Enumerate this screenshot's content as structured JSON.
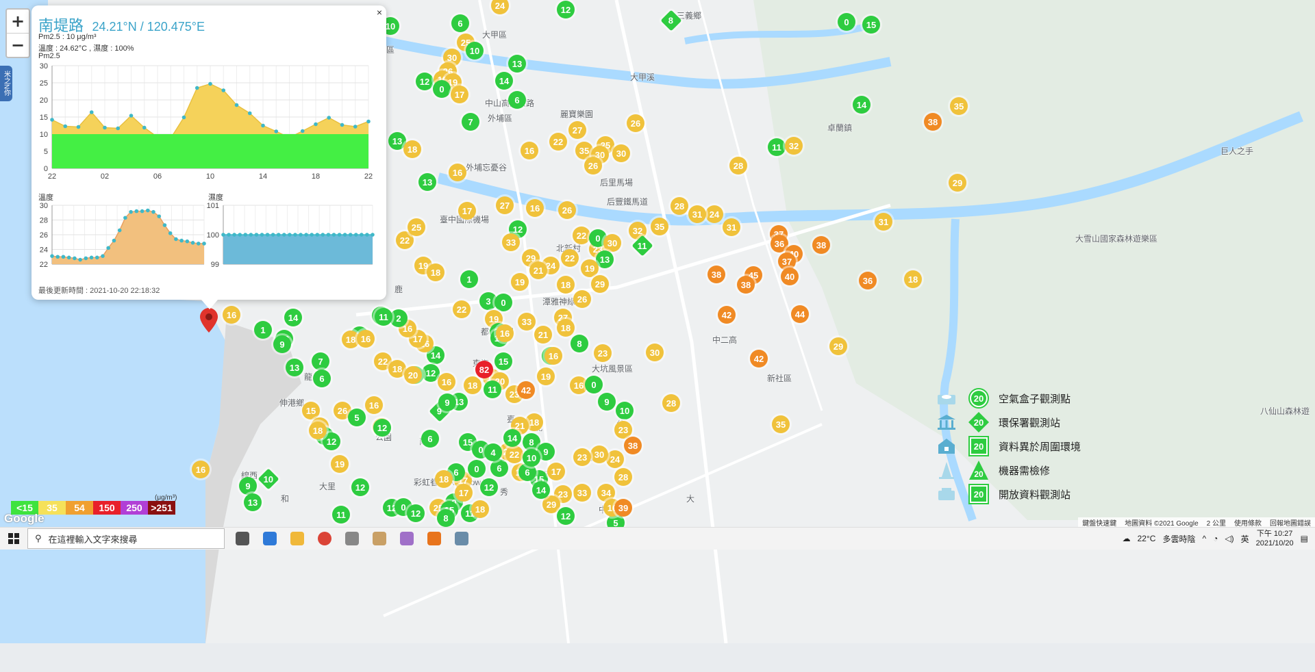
{
  "popup": {
    "station_name": "南堤路",
    "coordinates": "24.21°N / 120.475°E",
    "pm25_reading": "Pm2.5 : 10 μg/m³",
    "temp_humidity": "溫度 : 24.62°C , 濕度 : 100%",
    "pm25_chart_title": "Pm2.5",
    "temp_chart_title": "溫度",
    "humidity_chart_title": "濕度",
    "last_update": "最後更新時間 : 2021-10-20 22:18:32",
    "close_label": "×"
  },
  "chart_data": [
    {
      "type": "area",
      "title": "Pm2.5",
      "x_ticks": [
        "22",
        "02",
        "06",
        "10",
        "14",
        "18",
        "22"
      ],
      "ylim": [
        0,
        30
      ],
      "y_ticks": [
        0,
        5,
        10,
        15,
        20,
        25,
        30
      ],
      "grid": true,
      "series": [
        {
          "values": [
            14.2,
            12.3,
            12.1,
            16.4,
            11.9,
            11.7,
            15.4,
            11.9,
            9.1,
            8.8,
            14.9,
            23.5,
            24.7,
            22.8,
            18.5,
            16.1,
            12.5,
            10.8,
            9.0,
            10.9,
            12.9,
            14.8,
            12.7,
            12.2,
            13.7
          ]
        },
        {
          "values": [
            10,
            10,
            10,
            10,
            10,
            10,
            10,
            10,
            10,
            10,
            10,
            10,
            10,
            10,
            10,
            10,
            10,
            10,
            10,
            10,
            10,
            10,
            10,
            10,
            10
          ]
        }
      ]
    },
    {
      "type": "area",
      "title": "溫度",
      "ylim": [
        22,
        30
      ],
      "y_ticks": [
        22,
        24,
        26,
        28,
        30
      ],
      "grid": true,
      "values": [
        23.1,
        23.0,
        23.0,
        22.9,
        22.8,
        22.6,
        22.8,
        22.9,
        22.9,
        23.1,
        24.2,
        25.2,
        26.6,
        28.3,
        29.1,
        29.2,
        29.2,
        29.3,
        29.1,
        28.5,
        27.3,
        26.2,
        25.4,
        25.2,
        25.1,
        24.9,
        24.8,
        24.8
      ]
    },
    {
      "type": "area",
      "title": "濕度",
      "ylim": [
        99,
        101
      ],
      "y_ticks": [
        99,
        100,
        101
      ],
      "grid": true,
      "values": [
        100,
        100,
        100,
        100,
        100,
        100,
        100,
        100,
        100,
        100,
        100,
        100,
        100,
        100,
        100,
        100,
        100,
        100,
        100,
        100,
        100,
        100,
        100,
        100,
        100,
        100,
        100,
        100
      ]
    }
  ],
  "map": {
    "zoom_in": "+",
    "zoom_out": "−",
    "side_tab": "米之N你",
    "highlighted_value": "82",
    "places": [
      "三義鄉",
      "大甲區",
      "大安區",
      "外埔區",
      "中山高速公路",
      "麗寶樂園",
      "外埔忘憂谷",
      "卓蘭鎮",
      "巨人之手",
      "后里馬場",
      "后豐鐵馬道",
      "臺中國際機場",
      "北新村",
      "潭雅神綠園",
      "大坑風景區",
      "新社區",
      "中二高",
      "都會公園",
      "東海",
      "伸港鄉",
      "和",
      "線西",
      "大里",
      "彩虹眷村 Rainbow V",
      "大雪山國家森林遊樂區",
      "八仙山森林遊",
      "南",
      "龍",
      "公園",
      "大甲溪",
      "秀",
      "鹿",
      "大",
      "光",
      "石",
      "西",
      "北",
      "公",
      "臺",
      "大",
      "中"
    ],
    "markers": [
      {
        "v": "10",
        "c": "#2ecc40"
      },
      {
        "v": "24",
        "c": "#f0c23b"
      },
      {
        "v": "12",
        "c": "#2ecc40"
      },
      {
        "v": "8",
        "c": "#2ecc40",
        "d": true
      },
      {
        "v": "0",
        "c": "#2ecc40"
      },
      {
        "v": "15",
        "c": "#2ecc40"
      },
      {
        "v": "6",
        "c": "#2ecc40"
      },
      {
        "v": "25",
        "c": "#f0c23b"
      },
      {
        "v": "10",
        "c": "#2ecc40"
      },
      {
        "v": "30",
        "c": "#f0c23b"
      },
      {
        "v": "13",
        "c": "#2ecc40"
      },
      {
        "v": "26",
        "c": "#f0c23b"
      },
      {
        "v": "12",
        "c": "#2ecc40"
      },
      {
        "v": "18",
        "c": "#f0c23b"
      },
      {
        "v": "19",
        "c": "#f0c23b"
      },
      {
        "v": "0",
        "c": "#2ecc40"
      },
      {
        "v": "17",
        "c": "#f0c23b"
      },
      {
        "v": "14",
        "c": "#2ecc40"
      },
      {
        "v": "6",
        "c": "#2ecc40"
      },
      {
        "v": "7",
        "c": "#2ecc40"
      },
      {
        "v": "27",
        "c": "#f0c23b"
      },
      {
        "v": "26",
        "c": "#f0c23b"
      },
      {
        "v": "14",
        "c": "#2ecc40"
      },
      {
        "v": "38",
        "c": "#f08a24"
      },
      {
        "v": "35",
        "c": "#f0c23b"
      },
      {
        "v": "13",
        "c": "#2ecc40"
      },
      {
        "v": "18",
        "c": "#f0c23b"
      },
      {
        "v": "16",
        "c": "#f0c23b"
      },
      {
        "v": "22",
        "c": "#f0c23b"
      },
      {
        "v": "35",
        "c": "#f0c23b"
      },
      {
        "v": "25",
        "c": "#f0c23b"
      },
      {
        "v": "30",
        "c": "#f0c23b"
      },
      {
        "v": "30",
        "c": "#f0c23b"
      },
      {
        "v": "26",
        "c": "#f0c23b"
      },
      {
        "v": "11",
        "c": "#2ecc40"
      },
      {
        "v": "32",
        "c": "#f0c23b"
      },
      {
        "v": "28",
        "c": "#f0c23b"
      },
      {
        "v": "13",
        "c": "#2ecc40"
      },
      {
        "v": "16",
        "c": "#f0c23b"
      },
      {
        "v": "29",
        "c": "#f0c23b"
      },
      {
        "v": "17",
        "c": "#f0c23b"
      },
      {
        "v": "27",
        "c": "#f0c23b"
      },
      {
        "v": "16",
        "c": "#f0c23b"
      },
      {
        "v": "26",
        "c": "#f0c23b"
      },
      {
        "v": "22",
        "c": "#f0c23b"
      },
      {
        "v": "12",
        "c": "#2ecc40"
      },
      {
        "v": "33",
        "c": "#f0c23b"
      },
      {
        "v": "31",
        "c": "#f0c23b"
      },
      {
        "v": "28",
        "c": "#f0c23b"
      },
      {
        "v": "24",
        "c": "#f0c23b"
      },
      {
        "v": "35",
        "c": "#f0c23b"
      },
      {
        "v": "32",
        "c": "#f0c23b"
      },
      {
        "v": "31",
        "c": "#f0c23b"
      },
      {
        "v": "31",
        "c": "#f0c23b"
      },
      {
        "v": "25",
        "c": "#f0c23b"
      },
      {
        "v": "22",
        "c": "#f0c23b"
      },
      {
        "v": "23",
        "c": "#f0c23b"
      },
      {
        "v": "0",
        "c": "#2ecc40"
      },
      {
        "v": "30",
        "c": "#f0c23b"
      },
      {
        "v": "11",
        "c": "#2ecc40",
        "d": true
      },
      {
        "v": "37",
        "c": "#f08a24"
      },
      {
        "v": "36",
        "c": "#f08a24"
      },
      {
        "v": "40",
        "c": "#f08a24"
      },
      {
        "v": "37",
        "c": "#f08a24"
      },
      {
        "v": "40",
        "c": "#f08a24"
      },
      {
        "v": "38",
        "c": "#f08a24"
      },
      {
        "v": "29",
        "c": "#f0c23b"
      },
      {
        "v": "24",
        "c": "#f0c23b"
      },
      {
        "v": "21",
        "c": "#f0c23b"
      },
      {
        "v": "22",
        "c": "#f0c23b"
      },
      {
        "v": "13",
        "c": "#2ecc40"
      },
      {
        "v": "19",
        "c": "#f0c23b"
      },
      {
        "v": "19",
        "c": "#f0c23b"
      },
      {
        "v": "18",
        "c": "#f0c23b"
      },
      {
        "v": "1",
        "c": "#2ecc40"
      },
      {
        "v": "19",
        "c": "#f0c23b"
      },
      {
        "v": "18",
        "c": "#f0c23b"
      },
      {
        "v": "29",
        "c": "#f0c23b"
      },
      {
        "v": "26",
        "c": "#f0c23b"
      },
      {
        "v": "38",
        "c": "#f08a24"
      },
      {
        "v": "45",
        "c": "#f08a24"
      },
      {
        "v": "38",
        "c": "#f08a24"
      },
      {
        "v": "36",
        "c": "#f08a24"
      },
      {
        "v": "18",
        "c": "#f0c23b"
      },
      {
        "v": "42",
        "c": "#f08a24"
      },
      {
        "v": "44",
        "c": "#f08a24"
      },
      {
        "v": "29",
        "c": "#f0c23b"
      },
      {
        "v": "42",
        "c": "#f08a24"
      },
      {
        "v": "30",
        "c": "#f0c23b"
      },
      {
        "v": "28",
        "c": "#f0c23b"
      },
      {
        "v": "35",
        "c": "#f0c23b"
      },
      {
        "v": "3",
        "c": "#2ecc40"
      },
      {
        "v": "0",
        "c": "#2ecc40"
      },
      {
        "v": "22",
        "c": "#f0c23b"
      },
      {
        "v": "19",
        "c": "#f0c23b"
      },
      {
        "v": "33",
        "c": "#f0c23b"
      },
      {
        "v": "14",
        "c": "#2ecc40"
      },
      {
        "v": "14",
        "c": "#2ecc40"
      },
      {
        "v": "16",
        "c": "#f0c23b"
      },
      {
        "v": "21",
        "c": "#f0c23b"
      },
      {
        "v": "27",
        "c": "#f0c23b"
      },
      {
        "v": "18",
        "c": "#f0c23b"
      },
      {
        "v": "8",
        "c": "#2ecc40"
      },
      {
        "v": "23",
        "c": "#f0c23b"
      },
      {
        "v": "5",
        "c": "#2ecc40"
      },
      {
        "v": "16",
        "c": "#f0c23b"
      },
      {
        "v": "15",
        "c": "#2ecc40"
      },
      {
        "v": "82",
        "c": "#e8202a"
      },
      {
        "v": "18",
        "c": "#f0c23b"
      },
      {
        "v": "20",
        "c": "#f0c23b"
      },
      {
        "v": "23",
        "c": "#f0c23b"
      },
      {
        "v": "42",
        "c": "#f08a24"
      },
      {
        "v": "11",
        "c": "#2ecc40"
      },
      {
        "v": "19",
        "c": "#f0c23b"
      },
      {
        "v": "16",
        "c": "#f0c23b"
      },
      {
        "v": "0",
        "c": "#2ecc40"
      },
      {
        "v": "9",
        "c": "#2ecc40"
      },
      {
        "v": "18",
        "c": "#f0c23b"
      },
      {
        "v": "10",
        "c": "#2ecc40"
      },
      {
        "v": "23",
        "c": "#f0c23b"
      },
      {
        "v": "38",
        "c": "#f08a24"
      },
      {
        "v": "24",
        "c": "#f0c23b"
      },
      {
        "v": "30",
        "c": "#f0c23b"
      },
      {
        "v": "28",
        "c": "#f0c23b"
      },
      {
        "v": "23",
        "c": "#f0c23b"
      },
      {
        "v": "33",
        "c": "#f0c23b"
      },
      {
        "v": "5",
        "c": "#2ecc40"
      },
      {
        "v": "34",
        "c": "#f0c23b"
      },
      {
        "v": "16",
        "c": "#f0c23b"
      },
      {
        "v": "39",
        "c": "#f08a24"
      },
      {
        "v": "23",
        "c": "#f0c23b"
      },
      {
        "v": "29",
        "c": "#f0c23b"
      },
      {
        "v": "12",
        "c": "#2ecc40"
      },
      {
        "v": "15",
        "c": "#2ecc40"
      },
      {
        "v": "17",
        "c": "#f0c23b"
      },
      {
        "v": "6",
        "c": "#2ecc40"
      },
      {
        "v": "18",
        "c": "#f0c23b"
      },
      {
        "v": "12",
        "c": "#2ecc40"
      },
      {
        "v": "0",
        "c": "#2ecc40"
      },
      {
        "v": "17",
        "c": "#f0c23b"
      },
      {
        "v": "25",
        "c": "#f0c23b"
      },
      {
        "v": "9",
        "c": "#2ecc40",
        "d": true
      },
      {
        "v": "6",
        "c": "#2ecc40"
      },
      {
        "v": "25",
        "c": "#f0c23b"
      },
      {
        "v": "18",
        "c": "#f0c23b"
      },
      {
        "v": "21",
        "c": "#f0c23b"
      },
      {
        "v": "14",
        "c": "#2ecc40"
      },
      {
        "v": "12",
        "c": "#2ecc40"
      },
      {
        "v": "9",
        "c": "#2ecc40"
      },
      {
        "v": "16",
        "c": "#f0c23b"
      },
      {
        "v": "26",
        "c": "#f0c23b"
      },
      {
        "v": "17",
        "c": "#f0c23b"
      },
      {
        "v": "22",
        "c": "#f0c23b"
      },
      {
        "v": "18",
        "c": "#f0c23b"
      },
      {
        "v": "20",
        "c": "#f0c23b"
      },
      {
        "v": "16",
        "c": "#f0c23b"
      },
      {
        "v": "13",
        "c": "#2ecc40"
      },
      {
        "v": "9",
        "c": "#2ecc40"
      },
      {
        "v": "16",
        "c": "#f0c23b"
      },
      {
        "v": "14",
        "c": "#2ecc40"
      },
      {
        "v": "18",
        "c": "#f0c23b"
      },
      {
        "v": "16",
        "c": "#f0c23b"
      },
      {
        "v": "14",
        "c": "#2ecc40"
      },
      {
        "v": "7",
        "c": "#2ecc40"
      },
      {
        "v": "6",
        "c": "#2ecc40"
      },
      {
        "v": "2",
        "c": "#2ecc40"
      },
      {
        "v": "11",
        "c": "#2ecc40"
      },
      {
        "v": "16",
        "c": "#f0c23b"
      },
      {
        "v": "14",
        "c": "#2ecc40"
      },
      {
        "v": "1",
        "c": "#2ecc40"
      },
      {
        "v": "13",
        "c": "#2ecc40"
      },
      {
        "v": "9",
        "c": "#2ecc40"
      },
      {
        "v": "13",
        "c": "#2ecc40"
      },
      {
        "v": "15",
        "c": "#f0c23b"
      },
      {
        "v": "21",
        "c": "#f0c23b"
      },
      {
        "v": "14",
        "c": "#2ecc40"
      },
      {
        "v": "12",
        "c": "#2ecc40"
      },
      {
        "v": "18",
        "c": "#f0c23b"
      },
      {
        "v": "16",
        "c": "#f0c23b"
      },
      {
        "v": "5",
        "c": "#2ecc40"
      },
      {
        "v": "12",
        "c": "#2ecc40"
      },
      {
        "v": "19",
        "c": "#f0c23b"
      },
      {
        "v": "12",
        "c": "#2ecc40"
      },
      {
        "v": "16",
        "c": "#f0c23b"
      },
      {
        "v": "10",
        "c": "#2ecc40",
        "d": true
      },
      {
        "v": "9",
        "c": "#2ecc40"
      },
      {
        "v": "13",
        "c": "#2ecc40"
      },
      {
        "v": "11",
        "c": "#2ecc40"
      },
      {
        "v": "12",
        "c": "#2ecc40"
      },
      {
        "v": "0",
        "c": "#2ecc40"
      },
      {
        "v": "12",
        "c": "#2ecc40"
      },
      {
        "v": "15",
        "c": "#2ecc40"
      },
      {
        "v": "11",
        "c": "#2ecc40"
      },
      {
        "v": "18",
        "c": "#f0c23b"
      },
      {
        "v": "8",
        "c": "#2ecc40"
      },
      {
        "v": "0",
        "c": "#2ecc40"
      },
      {
        "v": "6",
        "c": "#2ecc40"
      },
      {
        "v": "19",
        "c": "#f0c23b"
      },
      {
        "v": "14",
        "c": "#2ecc40"
      },
      {
        "v": "17",
        "c": "#f0c23b"
      },
      {
        "v": "23",
        "c": "#f0c23b"
      },
      {
        "v": "22",
        "c": "#f0c23b"
      },
      {
        "v": "6",
        "c": "#2ecc40"
      },
      {
        "v": "8",
        "c": "#2ecc40"
      },
      {
        "v": "9",
        "c": "#2ecc40"
      },
      {
        "v": "10",
        "c": "#2ecc40"
      },
      {
        "v": "15",
        "c": "#2ecc40"
      },
      {
        "v": "0",
        "c": "#2ecc40"
      },
      {
        "v": "4",
        "c": "#2ecc40"
      },
      {
        "v": "14",
        "c": "#2ecc40"
      }
    ]
  },
  "legend": {
    "badge_value": "20",
    "items": [
      {
        "label": "空氣盒子觀測點",
        "icon": "cloud-box-icon",
        "shape": "circle"
      },
      {
        "label": "環保署觀測站",
        "icon": "government-building-icon",
        "shape": "diamond"
      },
      {
        "label": "資料異於周圍環境",
        "icon": "house-icon",
        "shape": "square"
      },
      {
        "label": "機器需檢修",
        "icon": "traffic-cone-icon",
        "shape": "triangle"
      },
      {
        "label": "開放資料觀測站",
        "icon": "open-data-icon",
        "shape": "square"
      }
    ]
  },
  "scale": {
    "unit": "(μg/m³)",
    "items": [
      {
        "label": "<15",
        "color": "#3ee33e"
      },
      {
        "label": "35",
        "color": "#f5e15a"
      },
      {
        "label": "54",
        "color": "#f0a030"
      },
      {
        "label": "150",
        "color": "#e8202a"
      },
      {
        "label": "250",
        "color": "#b13fd6"
      },
      {
        "label": ">251",
        "color": "#8a1010"
      }
    ]
  },
  "map_footer": {
    "google": "Google",
    "shortcuts": "鍵盤快速鍵",
    "map_data": "地圖資料 ©2021 Google",
    "scale_text": "2 公里",
    "terms": "使用條款",
    "report": "回報地圖錯誤"
  },
  "taskbar": {
    "search_placeholder": "在這裡輸入文字來搜尋",
    "weather_temp": "22°C",
    "weather_desc": "多雲時陰",
    "ime": "英",
    "time": "下午 10:27",
    "date": "2021/10/20",
    "apps": [
      "task-view-icon",
      "edge-icon",
      "file-explorer-icon",
      "chrome-icon",
      "compass-icon",
      "bird-icon",
      "snipping-icon",
      "blender-icon",
      "app-icon"
    ]
  },
  "colors": {
    "green": "#2ecc40",
    "yellow": "#f0c23b",
    "orange": "#f08a24",
    "red": "#e8202a",
    "popup_accent": "#3aa3c9",
    "pm_area": "#f5d25a",
    "pm_base": "#44ef44",
    "temp_area": "#f2c07e",
    "hum_area": "#6cbad9"
  }
}
